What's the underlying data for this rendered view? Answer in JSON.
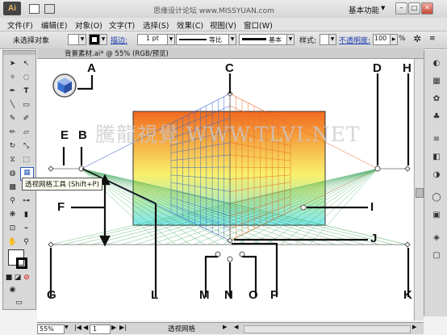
{
  "menubar": {
    "logo": "Ai",
    "items": [
      "文件(F)",
      "编辑(E)",
      "对象(O)",
      "文字(T)",
      "选择(S)",
      "效果(C)",
      "视图(V)",
      "窗口(W)"
    ],
    "workspace": "基本功能",
    "watermark": "思缘设计论坛 www.MISSYUAN.com"
  },
  "controlbar": {
    "selection": "未选择对象",
    "stroke_label": "描边:",
    "stroke_value": "1 pt",
    "stroke_profile": "等比",
    "brush": "基本",
    "style_label": "样式:",
    "opacity_label": "不透明度:",
    "opacity_value": "100",
    "percent": "%"
  },
  "document": {
    "tab_title": "背景素材.ai* @ 55% (RGB/预览)",
    "tooltip": "透视网格工具 (Shift+P)",
    "watermark": "騰龍視覺 WWW.TLVI.NET",
    "labels": [
      "A",
      "B",
      "C",
      "D",
      "E",
      "F",
      "G",
      "H",
      "I",
      "J",
      "K",
      "L",
      "M",
      "N",
      "O",
      "P"
    ]
  },
  "status": {
    "zoom": "55%",
    "page": "1",
    "tool": "透视网格"
  },
  "colors": {
    "gradient_top": "#f26a1e",
    "gradient_mid": "#f9f06b",
    "gradient_bottom": "#7fe8f0",
    "grid_left": "#3a64c8",
    "grid_right": "#e86a2a",
    "grid_ground": "#2fa050"
  }
}
